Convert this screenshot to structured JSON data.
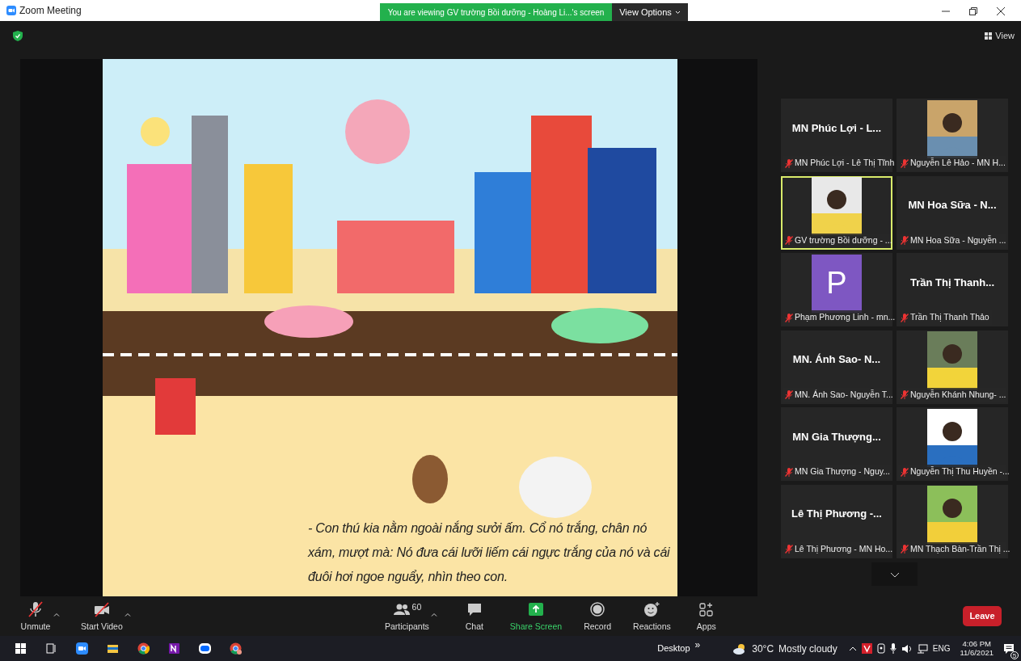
{
  "window": {
    "title": "Zoom Meeting"
  },
  "share_banner": {
    "text": "You are viewing GV trường Bồi dưỡng - Hoàng Li...'s screen",
    "button": "View Options"
  },
  "view_button": "View",
  "slide": {
    "caption": "- Con thú kia nằm ngoài nắng sưởi ấm. Cổ nó trắng, chân nó xám, mượt mà: Nó đưa cái lưỡi liếm cái ngực trắng của nó và cái đuôi hơi ngoe nguẩy, nhìn theo con."
  },
  "participants": [
    {
      "kind": "name",
      "display": "MN Phúc Lợi - L...",
      "label": "MN Phúc Lợi - Lê Thị Tĩnh",
      "muted": true,
      "speaking": false
    },
    {
      "kind": "picture",
      "label": "Nguyễn Lê Hảo - MN H...",
      "muted": true,
      "speaking": false
    },
    {
      "kind": "picture",
      "label": "GV trường Bồi dưỡng - ...",
      "muted": true,
      "speaking": true
    },
    {
      "kind": "name",
      "display": "MN Hoa Sữa - N...",
      "label": "MN Hoa Sữa - Nguyễn ...",
      "muted": true,
      "speaking": false
    },
    {
      "kind": "avatar",
      "display": "P",
      "label": "Phạm Phương Linh - mn...",
      "muted": true,
      "speaking": false
    },
    {
      "kind": "name",
      "display": "Trần Thị Thanh...",
      "label": "Trần Thị Thanh Thảo",
      "muted": true,
      "speaking": false
    },
    {
      "kind": "name",
      "display": "MN. Ánh Sao- N...",
      "label": "MN. Ánh Sao- Nguyễn T...",
      "muted": true,
      "speaking": false
    },
    {
      "kind": "picture",
      "label": "Nguyễn Khánh Nhung- ...",
      "muted": true,
      "speaking": false
    },
    {
      "kind": "name",
      "display": "MN Gia Thượng...",
      "label": "MN Gia Thượng - Nguy...",
      "muted": true,
      "speaking": false
    },
    {
      "kind": "picture",
      "label": "Nguyễn Thị Thu Huyền -...",
      "muted": true,
      "speaking": false
    },
    {
      "kind": "name",
      "display": "Lê Thị Phương -...",
      "label": "Lê Thị Phương - MN Ho...",
      "muted": true,
      "speaking": false
    },
    {
      "kind": "picture",
      "label": "MN Thạch Bàn-Trần Thị ...",
      "muted": true,
      "speaking": false
    }
  ],
  "toolbar_left": [
    {
      "kind": "mic",
      "label": "Unmute",
      "off": true
    },
    {
      "kind": "video",
      "label": "Start Video",
      "off": true
    }
  ],
  "toolbar_center": [
    {
      "kind": "participants",
      "label": "Participants",
      "count": "60"
    },
    {
      "kind": "chat",
      "label": "Chat"
    },
    {
      "kind": "share",
      "label": "Share Screen"
    },
    {
      "kind": "record",
      "label": "Record"
    },
    {
      "kind": "reactions",
      "label": "Reactions"
    },
    {
      "kind": "apps",
      "label": "Apps"
    }
  ],
  "leave_button": "Leave",
  "taskbar": {
    "desktop": "Desktop",
    "chevron": "»",
    "temperature": "30°C",
    "weather": "Mostly cloudy",
    "language": "ENG",
    "time": "4:06 PM",
    "date": "11/6/2021",
    "notifications": "5"
  }
}
